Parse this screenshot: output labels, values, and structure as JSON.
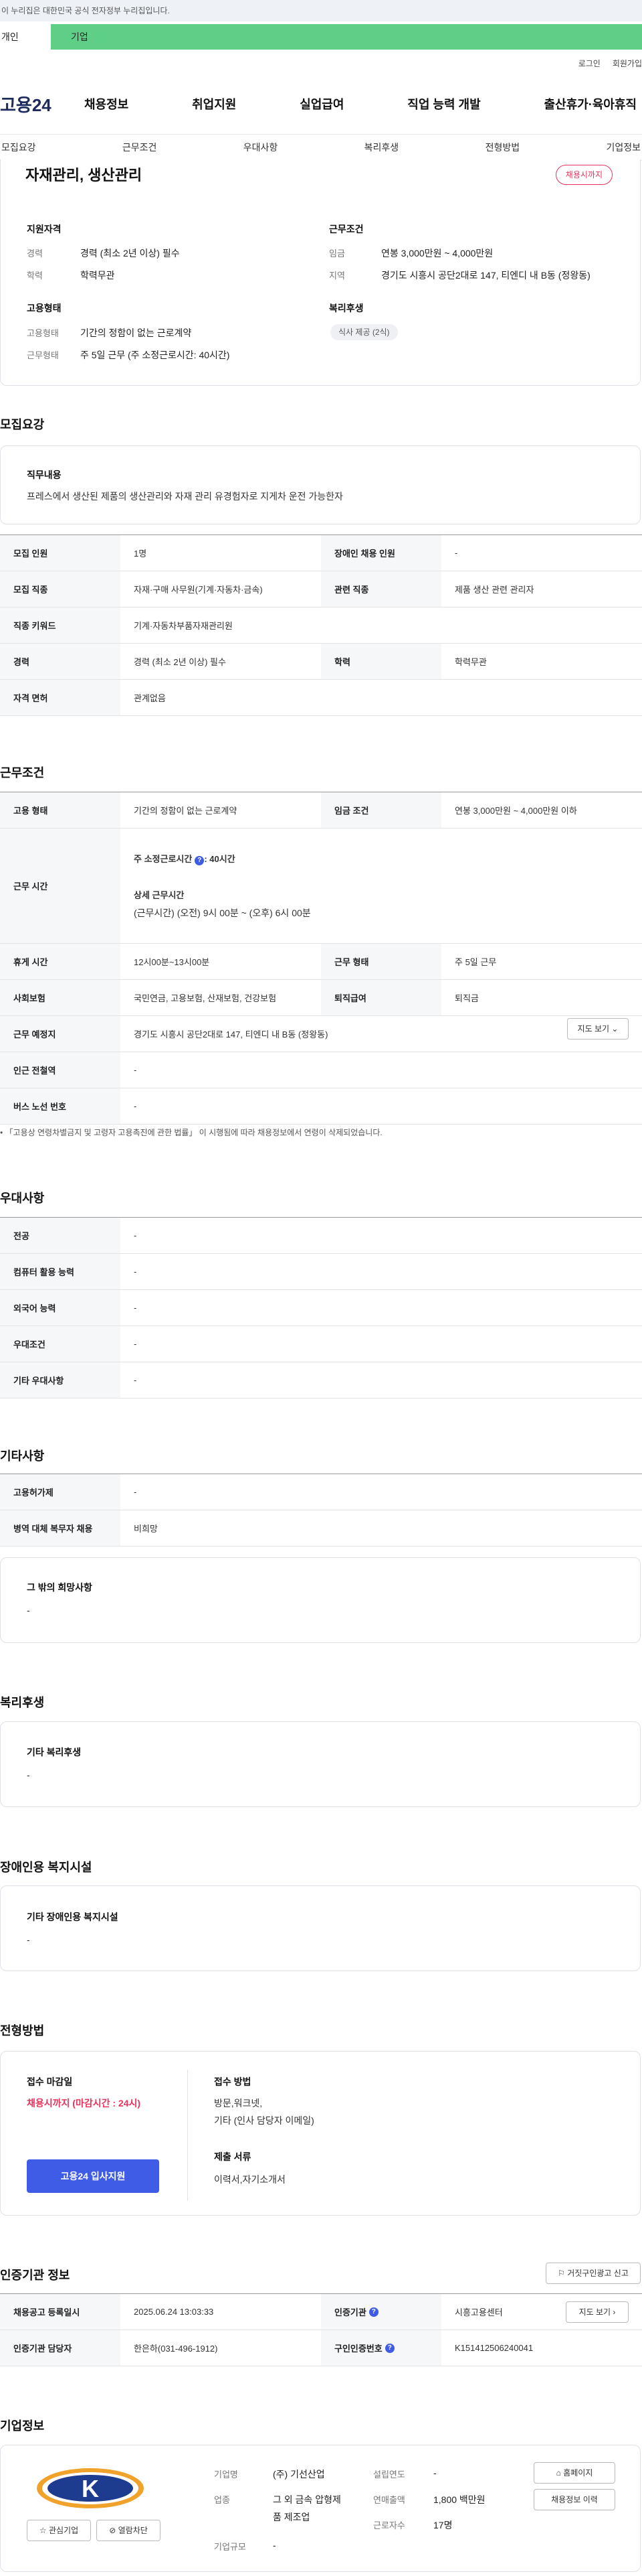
{
  "gov_banner": "이 누리집은 대한민국 공식 전자정부 누리집입니다.",
  "user_tabs": [
    "개인",
    "기업"
  ],
  "util_links": [
    "로그인",
    "회원가입"
  ],
  "logo": "고용24",
  "gnb": [
    "채용정보",
    "취업지원",
    "실업급여",
    "직업 능력 개발",
    "출산휴가·육아휴직"
  ],
  "subnav": [
    "모집요강",
    "근무조건",
    "우대사항",
    "복리후생",
    "전형방법",
    "기업정보"
  ],
  "summary": {
    "title": "자재관리, 생산관리",
    "status": "채용시까지",
    "qual_head": "지원자격",
    "career_key": "경력",
    "career_val": "경력 (최소 2년 이상) 필수",
    "edu_key": "학력",
    "edu_val": "학력무관",
    "emp_head": "고용형태",
    "emp_key": "고용형태",
    "emp_val": "기간의 정함이 없는 근로계약",
    "hours_key": "근무형태",
    "hours_val": "주 5일 근무 (주 소정근로시간: 40시간)",
    "cond_head": "근무조건",
    "wage_key": "임금",
    "wage_val": "연봉 3,000만원 ~ 4,000만원",
    "region_key": "지역",
    "region_val": "경기도 시흥시 공단2대로 147, 티엔디 내 B동 (정왕동)",
    "welfare_head": "복리후생",
    "meal": "식사 제공 (2식)"
  },
  "recruit": {
    "title": "모집요강",
    "duty_head": "직무내용",
    "duty_text": "프레스에서 생산된 제품의 생산관리와 자재 관리 유경험자로 지게차 운전 가능한자",
    "rows": [
      {
        "k1": "모집 인원",
        "v1": "1명",
        "k2": "장애인 채용 인원",
        "v2": "-"
      },
      {
        "k1": "모집 직종",
        "v1": "자재·구매 사무원(기계·자동차·금속)",
        "k2": "관련 직종",
        "v2": "제품 생산 관련 관리자"
      },
      {
        "k1": "직종 키워드",
        "v1": "기계·자동차부품자재관리원"
      },
      {
        "k1": "경력",
        "v1": "경력 (최소 2년 이상) 필수",
        "k2": "학력",
        "v2": "학력무관"
      },
      {
        "k1": "자격 면허",
        "v1": "관계없음"
      }
    ]
  },
  "work": {
    "title": "근무조건",
    "type_k": "고용 형태",
    "type_v": "기간의 정함이 없는 근로계약",
    "wage_k": "임금 조건",
    "wage_v": "연봉 3,000만원 ~ 4,000만원 이하",
    "time_k": "근무 시간",
    "time_weekly": "주 소정근로시간",
    "time_weekly_val": ": 40시간",
    "time_detail_head": "상세 근무시간",
    "time_detail": "(근무시간) (오전) 9시 00분 ~ (오후) 6시 00분",
    "break_k": "휴게 시간",
    "break_v": "12시00분~13시00분",
    "form_k": "근무 형태",
    "form_v": "주 5일 근무",
    "ins_k": "사회보험",
    "ins_v": "국민연금, 고용보험, 산재보험, 건강보험",
    "ret_k": "퇴직급여",
    "ret_v": "퇴직금",
    "place_k": "근무 예정지",
    "place_v": "경기도 시흥시 공단2대로 147, 티엔디 내 B동 (정왕동)",
    "map_btn": "지도 보기",
    "station_k": "인근 전철역",
    "station_v": "-",
    "bus_k": "버스 노선 번호",
    "bus_v": "-",
    "note": "「고용상 연령차별금지 및 고령자 고용촉진에 관한 법률」 이 시행됨에 따라 채용정보에서 연령이 삭제되었습니다."
  },
  "pref": {
    "title": "우대사항",
    "rows": [
      {
        "k": "전공",
        "v": "-"
      },
      {
        "k": "컴퓨터 활용 능력",
        "v": "-"
      },
      {
        "k": "외국어 능력",
        "v": "-"
      },
      {
        "k": "우대조건",
        "v": "-"
      },
      {
        "k": "기타 우대사항",
        "v": "-"
      }
    ]
  },
  "etc": {
    "title": "기타사항",
    "rows": [
      {
        "k": "고용허가제",
        "v": "-"
      },
      {
        "k": "병역 대체 복무자 채용",
        "v": "비희망"
      }
    ],
    "box_head": "그 밖의 희망사항",
    "box_val": "-"
  },
  "welfare": {
    "title": "복리후생",
    "box_head": "기타 복리후생",
    "box_val": "-"
  },
  "disabled": {
    "title": "장애인용 복지시설",
    "box_head": "기타 장애인용 복지시설",
    "box_val": "-"
  },
  "selection": {
    "title": "전형방법",
    "deadline_head": "접수 마감일",
    "deadline_val": "채용시까지 (마감시간 : 24시)",
    "apply_btn": "고용24 입사지원",
    "method_head": "접수 방법",
    "method_val1": "방문,워크넷,",
    "method_val2": "기타 (인사 담당자 이메일)",
    "docs_head": "제출 서류",
    "docs_val": "이력서,자기소개서"
  },
  "cert": {
    "title": "인증기관 정보",
    "report_btn": "거짓구인광고 신고",
    "reg_k": "채용공고 등록일시",
    "reg_v": "2025.06.24 13:03:33",
    "org_k": "인증기관",
    "org_v": "시흥고용센터",
    "map_btn": "지도 보기",
    "mgr_k": "인증기관 담당자",
    "mgr_v": "한은하(031-496-1912)",
    "num_k": "구인인증번호",
    "num_v": "K151412506240041"
  },
  "company": {
    "title": "기업정보",
    "name_k": "기업명",
    "name_v": "(주) 기선산업",
    "industry_k": "업종",
    "industry_v1": "그 외 금속 압형제",
    "industry_v2": "품 제조업",
    "size_k": "기업규모",
    "size_v": "-",
    "year_k": "설립연도",
    "year_v": "-",
    "sales_k": "연매출액",
    "sales_v": "1,800 백만원",
    "emp_k": "근로자수",
    "emp_v": "17명",
    "fav_btn": "관심기업",
    "view_btn": "열람차단",
    "home_btn": "홈페이지",
    "info_btn": "채용정보 이력",
    "logo_letter": "K"
  }
}
